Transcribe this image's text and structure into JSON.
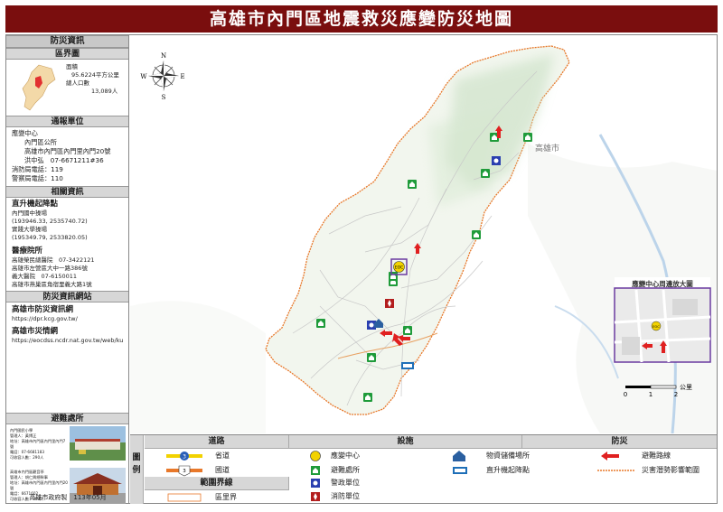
{
  "title": "高雄市內門區地震救災應變防災地圖",
  "left": {
    "header": "防災資訊",
    "district_map": {
      "header": "區界圖",
      "area_label": "面積",
      "area_value": "95.6224平方公里",
      "pop_label": "總人口數",
      "pop_value": "13,089人"
    },
    "notify": {
      "header": "通報單位",
      "center": "應變中心",
      "office": "內門區公所",
      "address": "高雄市內門區內門里內門20號",
      "contact": "洪中弘　07-6671211#36",
      "fire": "消防局電話：119",
      "police": "警察局電話：110"
    },
    "related": {
      "header": "相關資訊",
      "heli_title": "直升機起降點",
      "heli_1_name": "內門國中操場",
      "heli_1_coord": "(193946.33, 2535740.72)",
      "heli_2_name": "實踐大學操場",
      "heli_2_coord": "(195349.79, 2533820.05)",
      "medical_title": "醫療院所",
      "med_1": "高雄榮民總醫院　07-3422121",
      "med_2": "高雄市左營區大中一路386號",
      "med_3": "義大醫院　07-6150011",
      "med_4": "高雄市燕巢區角宿里義大路1號"
    },
    "web": {
      "header": "防災資訊網站",
      "site_1_name": "高雄市防災資訊網",
      "site_1_url": "https://dpr.kcg.gov.tw/",
      "site_2_name": "高雄市災情網",
      "site_2_url": "https://eocdss.ncdr.nat.gov.tw/web/ku"
    },
    "shelter": {
      "header": "避難處所",
      "s1_1": "內門國民小學",
      "s1_2": "管理人：黃博正",
      "s1_3": "地址：高雄市內門區內門里內門7號",
      "s1_4": "電話：07-6681183",
      "s1_5": "可收容人數：290人",
      "s2_1": "高雄市內門區觀音亭",
      "s2_2": "管理人：胡仁興總幹事",
      "s2_3": "地址：高雄市內門區內門里內門20號",
      "s2_4": "電話：6671602",
      "s2_5": "可收容人數：200人"
    },
    "footer": "高雄市政府製　113年05月"
  },
  "map": {
    "city_label": "高雄市",
    "compass": {
      "n": "N",
      "s": "S",
      "e": "E",
      "w": "W"
    },
    "inset_title": "應變中心周邊放大圖",
    "inset_eoc": "EOC",
    "scale": {
      "t0": "0",
      "t1": "1",
      "t2": "2",
      "unit": "公里"
    },
    "eoc_badge": "EOC"
  },
  "legend": {
    "tuli": "圖例",
    "road_h": "道路",
    "fac_h": "設施",
    "prev_h": "防災",
    "boundary_h": "範圍界線",
    "provincial": "省道",
    "county": "國道",
    "district_boundary": "區里界",
    "eoc": "應變中心",
    "shelter": "避難處所",
    "police": "警政單位",
    "fire": "消防單位",
    "warehouse": "物資儲備場所",
    "helipad": "直升機起降點",
    "evac_route": "避難路線",
    "hazard": "災害潛勢影響範圍",
    "provincial_num": "3",
    "county_num": "3"
  },
  "colors": {
    "banner": "#7a0e0e",
    "boundary": "#e8782a",
    "shelter": "#1f9b3a",
    "eoc": "#f2d200",
    "evac_arrow": "#e02020",
    "police": "#2a3fb0",
    "fire": "#b31e1e",
    "inset_border": "#6a3aa0"
  }
}
